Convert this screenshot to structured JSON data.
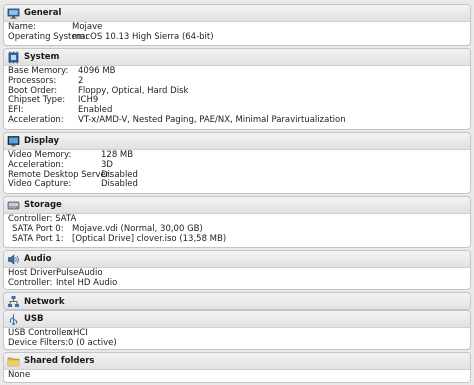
{
  "general": {
    "title": "General",
    "icon": "monitor-icon",
    "rows": [
      {
        "key": "Name:",
        "value": "Mojave"
      },
      {
        "key": "Operating System:",
        "value": "macOS 10.13 High Sierra (64-bit)"
      }
    ]
  },
  "system": {
    "title": "System",
    "icon": "chip-icon",
    "rows": [
      {
        "key": "Base Memory:",
        "value": "4096 MB"
      },
      {
        "key": "Processors:",
        "value": "2"
      },
      {
        "key": "Boot Order:",
        "value": "Floppy, Optical, Hard Disk"
      },
      {
        "key": "Chipset Type:",
        "value": "ICH9"
      },
      {
        "key": "EFI:",
        "value": "Enabled"
      },
      {
        "key": "Acceleration:",
        "value": "VT-x/AMD-V, Nested Paging, PAE/NX, Minimal Paravirtualization"
      }
    ]
  },
  "display": {
    "title": "Display",
    "icon": "display-icon",
    "rows": [
      {
        "key": "Video Memory:",
        "value": "128 MB"
      },
      {
        "key": "Acceleration:",
        "value": "3D"
      },
      {
        "key": "Remote Desktop Server:",
        "value": "Disabled"
      },
      {
        "key": "Video Capture:",
        "value": "Disabled"
      }
    ]
  },
  "storage": {
    "title": "Storage",
    "icon": "disk-icon",
    "controller": "Controller: SATA",
    "rows": [
      {
        "key": "SATA Port 0:",
        "value": "Mojave.vdi (Normal, 30,00 GB)"
      },
      {
        "key": "SATA Port 1:",
        "value": "[Optical Drive] clover.iso (13,58 MB)"
      }
    ]
  },
  "audio": {
    "title": "Audio",
    "icon": "speaker-icon",
    "rows": [
      {
        "key": "Host Driver:",
        "value": "PulseAudio"
      },
      {
        "key": "Controller:",
        "value": "Intel HD Audio"
      }
    ]
  },
  "network": {
    "title": "Network",
    "icon": "network-icon"
  },
  "usb": {
    "title": "USB",
    "icon": "usb-icon",
    "rows": [
      {
        "key": "USB Controller:",
        "value": "xHCI"
      },
      {
        "key": "Device Filters:",
        "value": "0 (0 active)"
      }
    ]
  },
  "shared_folders": {
    "title": "Shared folders",
    "icon": "folder-icon",
    "none_label": "None"
  }
}
